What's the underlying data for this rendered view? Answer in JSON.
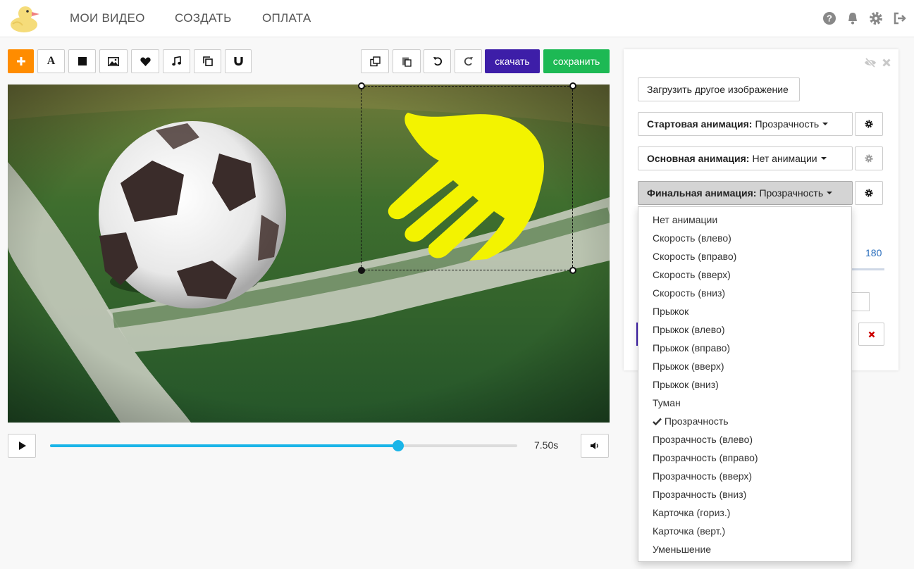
{
  "nav": {
    "items": [
      "МОИ ВИДЕО",
      "СОЗДАТЬ",
      "ОПЛАТА"
    ]
  },
  "topbar_icons": [
    "help-icon",
    "bell-icon",
    "gear-icon",
    "logout-icon"
  ],
  "toolbar": {
    "download_label": "скачать",
    "save_label": "сохранить",
    "text_tool_label": "A"
  },
  "colors": {
    "accent_orange": "#ff8c00",
    "download_purple": "#3d1ea8",
    "save_green": "#1db954",
    "timeline_blue": "#1ab5e8",
    "hand_yellow": "#f3f300",
    "remove_red": "#cc0000"
  },
  "player": {
    "time": "7.50s",
    "progress": 0.745
  },
  "panel": {
    "upload_label": "Загрузить другое изображение",
    "start_anim_label": "Стартовая анимация:",
    "start_anim_value": "Прозрачность",
    "main_anim_label": "Основная анимация:",
    "main_anim_value": "Нет анимации",
    "final_anim_label": "Финальная анимация:",
    "final_anim_value": "Прозрачность",
    "slider_value": "180"
  },
  "dropdown": {
    "selected": "Прозрачность",
    "options": [
      "Нет анимации",
      "Скорость (влево)",
      "Скорость (вправо)",
      "Скорость (вверх)",
      "Скорость (вниз)",
      "Прыжок",
      "Прыжок (влево)",
      "Прыжок (вправо)",
      "Прыжок (вверх)",
      "Прыжок (вниз)",
      "Туман",
      "Прозрачность",
      "Прозрачность (влево)",
      "Прозрачность (вправо)",
      "Прозрачность (вверх)",
      "Прозрачность (вниз)",
      "Карточка (гориз.)",
      "Карточка (верт.)",
      "Уменьшение"
    ]
  }
}
